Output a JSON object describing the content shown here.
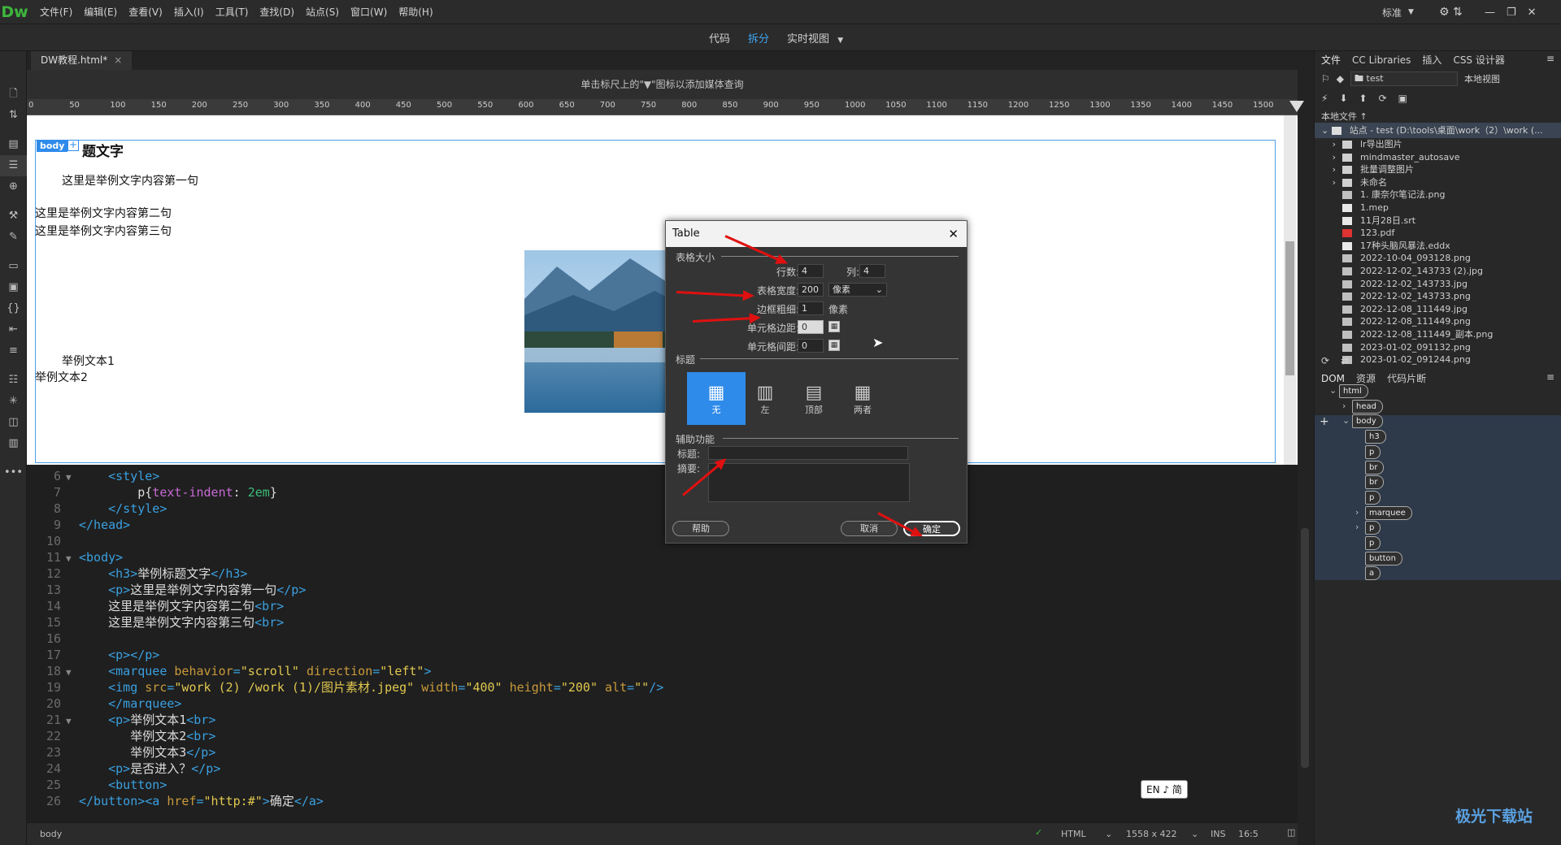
{
  "app": {
    "logo": "Dw",
    "menu": [
      "文件(F)",
      "编辑(E)",
      "查看(V)",
      "插入(I)",
      "工具(T)",
      "查找(D)",
      "站点(S)",
      "窗口(W)",
      "帮助(H)"
    ],
    "workspace": "标准"
  },
  "views": {
    "code": "代码",
    "split": "拆分",
    "live": "实时视图"
  },
  "doc": {
    "tab": "DW教程.html*",
    "mq_hint": "单击标尺上的\"▼\"图标以添加媒体查询"
  },
  "ruler": [
    "0",
    "50",
    "100",
    "150",
    "200",
    "250",
    "300",
    "350",
    "400",
    "450",
    "500",
    "550",
    "600",
    "650",
    "700",
    "750",
    "800",
    "850",
    "900",
    "950",
    "1000",
    "1050",
    "1100",
    "1150",
    "1200",
    "1250",
    "1300",
    "1350",
    "1400",
    "1450",
    "1500"
  ],
  "design": {
    "badge": "body",
    "heading": "题文字",
    "p1": "这里是举例文字内容第一句",
    "line2": "这里是举例文字内容第二句",
    "line3": "这里是举例文字内容第三句",
    "t1": "举例文本1",
    "t2": "举例文本2"
  },
  "code_lines": [
    {
      "n": "6",
      "f": "▼",
      "i": "    ",
      "h": "<span class='tag'>&lt;style&gt;</span>"
    },
    {
      "n": "7",
      "f": "",
      "i": "        ",
      "h": "<span class='txt'>p{</span><span class='prop'>text-indent</span><span class='txt'>: </span><span class='num'>2em</span><span class='txt'>}</span>"
    },
    {
      "n": "8",
      "f": "",
      "i": "    ",
      "h": "<span class='tag'>&lt;/style&gt;</span>"
    },
    {
      "n": "9",
      "f": "",
      "i": "",
      "h": "<span class='tag'>&lt;/head&gt;</span>"
    },
    {
      "n": "10",
      "f": "",
      "i": "",
      "h": ""
    },
    {
      "n": "11",
      "f": "▼",
      "i": "",
      "h": "<span class='tag'>&lt;body&gt;</span>"
    },
    {
      "n": "12",
      "f": "",
      "i": "    ",
      "h": "<span class='tag'>&lt;h3&gt;</span><span class='txt'>举例标题文字</span><span class='tag'>&lt;/h3&gt;</span>"
    },
    {
      "n": "13",
      "f": "",
      "i": "    ",
      "h": "<span class='tag'>&lt;p&gt;</span><span class='txt'>这里是举例文字内容第一句</span><span class='tag'>&lt;/p&gt;</span>"
    },
    {
      "n": "14",
      "f": "",
      "i": "    ",
      "h": "<span class='txt'>这里是举例文字内容第二句</span><span class='tag'>&lt;br&gt;</span>"
    },
    {
      "n": "15",
      "f": "",
      "i": "    ",
      "h": "<span class='txt'>这里是举例文字内容第三句</span><span class='tag'>&lt;br&gt;</span>"
    },
    {
      "n": "16",
      "f": "",
      "i": "",
      "h": ""
    },
    {
      "n": "17",
      "f": "",
      "i": "    ",
      "h": "<span class='tag'>&lt;p&gt;&lt;/p&gt;</span>"
    },
    {
      "n": "18",
      "f": "▼",
      "i": "    ",
      "h": "<span class='tag'>&lt;marquee </span><span class='attr'>behavior</span><span class='tag'>=</span><span class='val'>\"scroll\"</span><span class='attr'> direction</span><span class='tag'>=</span><span class='val'>\"left\"</span><span class='tag'>&gt;</span>"
    },
    {
      "n": "19",
      "f": "",
      "i": "    ",
      "h": "<span class='tag'>&lt;img </span><span class='attr'>src</span><span class='tag'>=</span><span class='val'>\"work (2) /work (1)/图片素材.jpeg\"</span><span class='attr'> width</span><span class='tag'>=</span><span class='val'>\"400\"</span><span class='attr'> height</span><span class='tag'>=</span><span class='val'>\"200\"</span><span class='attr'> alt</span><span class='tag'>=</span><span class='val'>\"\"</span><span class='tag'>/&gt;</span>"
    },
    {
      "n": "20",
      "f": "",
      "i": "    ",
      "h": "<span class='tag'>&lt;/marquee&gt;</span>"
    },
    {
      "n": "21",
      "f": "▼",
      "i": "    ",
      "h": "<span class='tag'>&lt;p&gt;</span><span class='txt'>举例文本1</span><span class='tag'>&lt;br&gt;</span>"
    },
    {
      "n": "22",
      "f": "",
      "i": "       ",
      "h": "<span class='txt'>举例文本2</span><span class='tag'>&lt;br&gt;</span>"
    },
    {
      "n": "23",
      "f": "",
      "i": "       ",
      "h": "<span class='txt'>举例文本3</span><span class='tag'>&lt;/p&gt;</span>"
    },
    {
      "n": "24",
      "f": "",
      "i": "    ",
      "h": "<span class='tag'>&lt;p&gt;</span><span class='txt'>是否进入？</span><span class='tag'>&lt;/p&gt;</span>"
    },
    {
      "n": "25",
      "f": "",
      "i": "    ",
      "h": "<span class='tag'>&lt;button&gt;</span>"
    },
    {
      "n": "26",
      "f": "",
      "i": "",
      "h": "<span class='tag'>&lt;/button&gt;&lt;a </span><span class='attr'>href</span><span class='tag'>=</span><span class='val'>\"http:#\"</span><span class='tag'>&gt;</span><span class='txt'>确定</span><span class='tag'>&lt;/a&gt;</span>"
    }
  ],
  "status": {
    "tag": "body",
    "lang": "HTML",
    "size": "1558 x 422",
    "mode": "INS",
    "pos": "16:5",
    "ime": "EN ♪ 简"
  },
  "panel": {
    "tabs": [
      "文件",
      "CC Libraries",
      "插入",
      "CSS 设计器"
    ],
    "site": "test",
    "view": "本地视图",
    "local_label": "本地文件 ↑",
    "site_root": "站点 - test (D:\\tools\\桌面\\work（2）\\work (...",
    "files": [
      {
        "name": "lr导出图片",
        "type": "folder"
      },
      {
        "name": "mindmaster_autosave",
        "type": "folder"
      },
      {
        "name": "批量调整图片",
        "type": "folder"
      },
      {
        "name": "未命名",
        "type": "folder"
      },
      {
        "name": "1. 康奈尔笔记法.png",
        "type": "img"
      },
      {
        "name": "1.mep",
        "type": "file"
      },
      {
        "name": "11月28日.srt",
        "type": "file"
      },
      {
        "name": "123.pdf",
        "type": "pdf"
      },
      {
        "name": "17种头脑风暴法.eddx",
        "type": "file"
      },
      {
        "name": "2022-10-04_093128.png",
        "type": "img"
      },
      {
        "name": "2022-12-02_143733 (2).jpg",
        "type": "img"
      },
      {
        "name": "2022-12-02_143733.jpg",
        "type": "img"
      },
      {
        "name": "2022-12-02_143733.png",
        "type": "img"
      },
      {
        "name": "2022-12-08_111449.jpg",
        "type": "img"
      },
      {
        "name": "2022-12-08_111449.png",
        "type": "img"
      },
      {
        "name": "2022-12-08_111449_副本.png",
        "type": "img"
      },
      {
        "name": "2023-01-02_091132.png",
        "type": "img"
      },
      {
        "name": "2023-01-02_091244.png",
        "type": "img"
      }
    ],
    "dom_tabs": [
      "DOM",
      "资源",
      "代码片断"
    ],
    "dom": [
      {
        "name": "html",
        "d": 0,
        "e": "⌄"
      },
      {
        "name": "head",
        "d": 1,
        "e": "›"
      },
      {
        "name": "body",
        "d": 1,
        "e": "⌄"
      },
      {
        "name": "h3",
        "d": 2,
        "e": ""
      },
      {
        "name": "p",
        "d": 2,
        "e": ""
      },
      {
        "name": "br",
        "d": 2,
        "e": ""
      },
      {
        "name": "br",
        "d": 2,
        "e": ""
      },
      {
        "name": "p",
        "d": 2,
        "e": ""
      },
      {
        "name": "marquee",
        "d": 2,
        "e": "›"
      },
      {
        "name": "p",
        "d": 2,
        "e": "›"
      },
      {
        "name": "p",
        "d": 2,
        "e": ""
      },
      {
        "name": "button",
        "d": 2,
        "e": ""
      },
      {
        "name": "a",
        "d": 2,
        "e": ""
      }
    ]
  },
  "dialog": {
    "title": "Table",
    "sec_size": "表格大小",
    "rows_label": "行数:",
    "rows": "4",
    "cols_label": "列:",
    "cols": "4",
    "width_label": "表格宽度:",
    "width": "200",
    "width_unit": "像素",
    "border_label": "边框粗细:",
    "border": "1",
    "border_unit": "像素",
    "pad_label": "单元格边距:",
    "pad": "0",
    "space_label": "单元格间距:",
    "space": "0",
    "sec_header": "标题",
    "header_opts": [
      "无",
      "左",
      "顶部",
      "两者"
    ],
    "sec_access": "辅助功能",
    "caption_label": "标题:",
    "summary_label": "摘要:",
    "help": "帮助",
    "cancel": "取消",
    "ok": "确定"
  },
  "accent": "#2f8bea"
}
